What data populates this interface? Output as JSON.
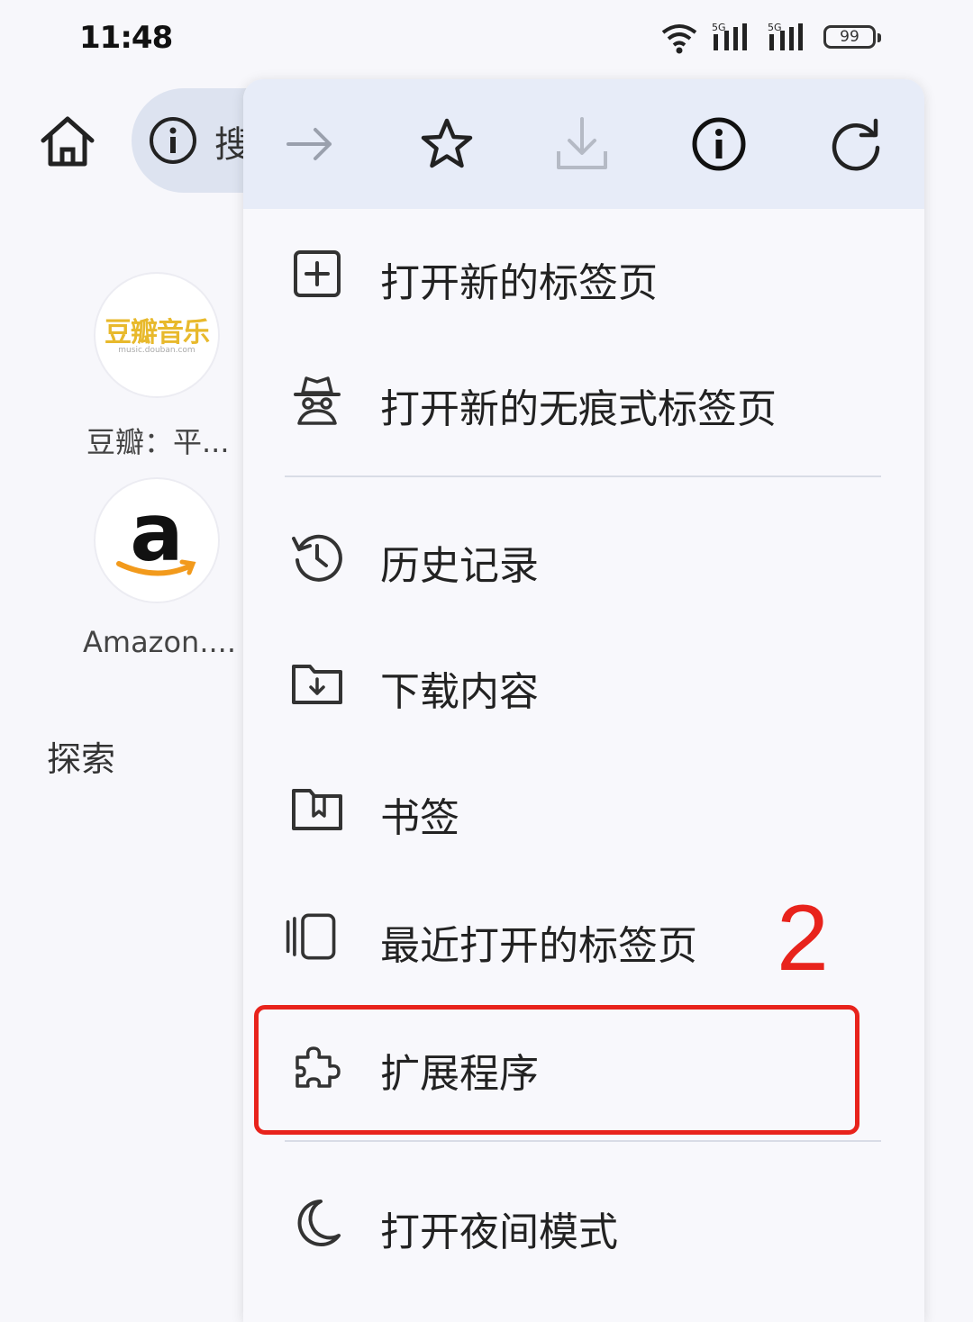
{
  "status_bar": {
    "time": "11:48",
    "battery": "99",
    "signal_labels": [
      "5G",
      "5G"
    ]
  },
  "browser": {
    "url_text": "搜"
  },
  "speed_dial": [
    {
      "label": "豆瓣：平...",
      "logo_text": "豆瓣音乐",
      "logo_sub": "music.douban.com"
    },
    {
      "label": "Amazon....",
      "logo_text": "a"
    }
  ],
  "explore_label": "探索",
  "menu": {
    "toolbar": [
      "forward-arrow-icon",
      "star-icon",
      "download-icon",
      "info-icon",
      "reload-icon"
    ],
    "items": [
      {
        "label": "打开新的标签页",
        "icon": "new-tab-icon"
      },
      {
        "label": "打开新的无痕式标签页",
        "icon": "incognito-icon"
      },
      {
        "label": "历史记录",
        "icon": "history-icon"
      },
      {
        "label": "下载内容",
        "icon": "downloads-folder-icon"
      },
      {
        "label": "书签",
        "icon": "bookmarks-folder-icon"
      },
      {
        "label": "最近打开的标签页",
        "icon": "recent-tabs-icon"
      },
      {
        "label": "扩展程序",
        "icon": "puzzle-icon"
      },
      {
        "label": "打开夜间模式",
        "icon": "moon-icon"
      }
    ]
  },
  "annotation": {
    "step_number": "2",
    "color": "#e8231c"
  }
}
